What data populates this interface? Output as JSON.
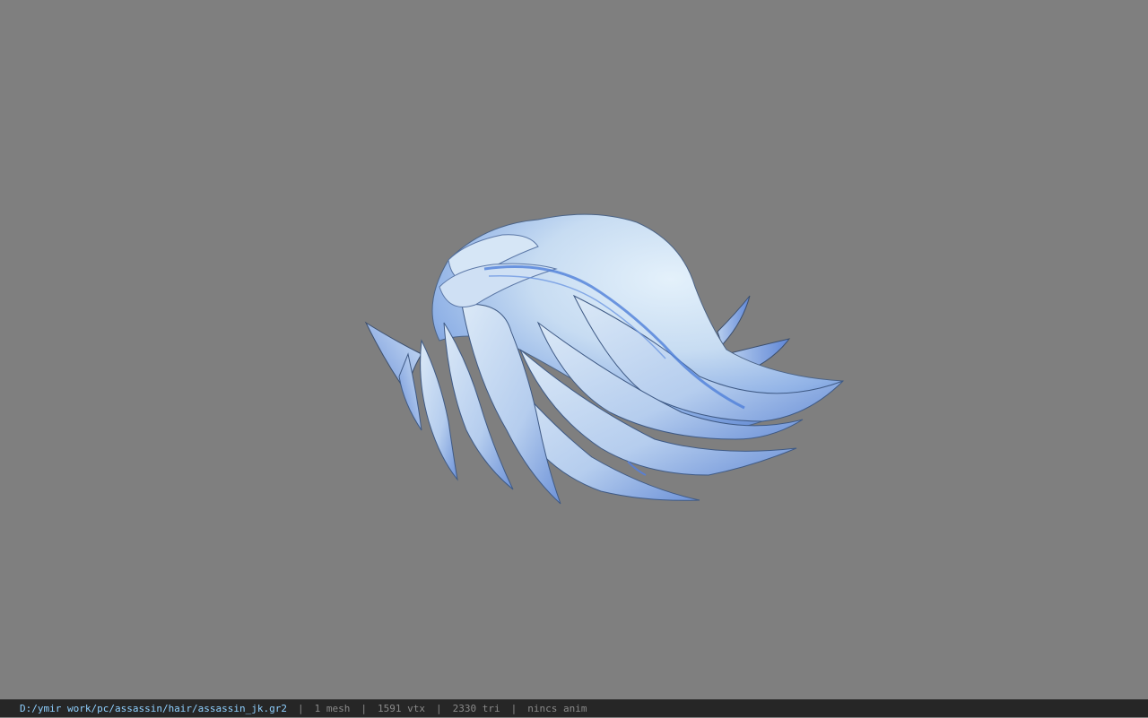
{
  "viewport": {
    "background_color": "#7f7f7f",
    "model": "hair-mesh"
  },
  "status_bar": {
    "file_path": "D:/ymir work/pc/assassin/hair/assassin_jk.gr2",
    "separator": "|",
    "mesh_count": "1 mesh",
    "vertex_count": "1591 vtx",
    "triangle_count": "2330 tri",
    "anim_status": "nincs anim",
    "path_color": "#8fd0ff",
    "text_color": "#8a8a8a"
  }
}
